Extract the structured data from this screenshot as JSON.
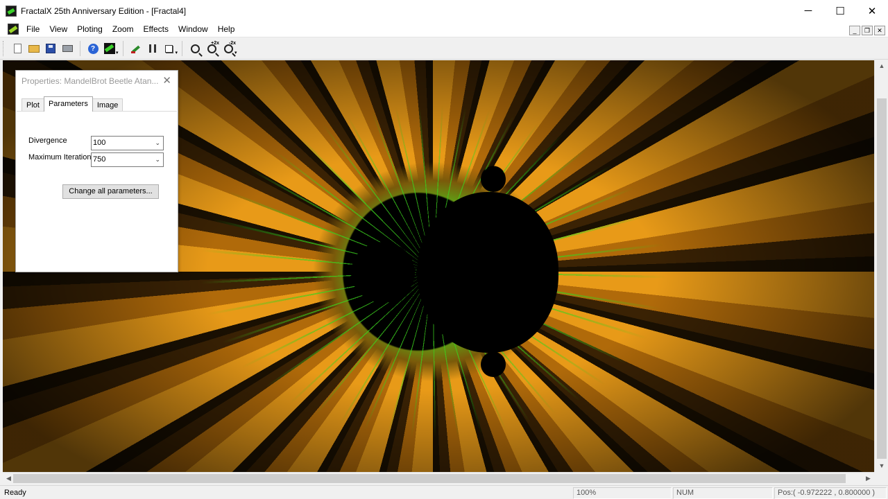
{
  "window": {
    "title": "FractalX 25th Anniversary Edition - [Fractal4]",
    "minimize": "─",
    "maximize": "☐",
    "close": "✕"
  },
  "menu": {
    "items": [
      "File",
      "View",
      "Ploting",
      "Zoom",
      "Effects",
      "Window",
      "Help"
    ],
    "mdi_minimize": "_",
    "mdi_restore": "❐",
    "mdi_close": "✕"
  },
  "toolbar": {
    "zoom_in_label": "+2x",
    "zoom_out_label": "-2x",
    "dropdown_glyph": "▾"
  },
  "properties": {
    "title": "Properties: MandelBrot Beetle Atan...",
    "close_glyph": "✕",
    "tabs": [
      "Plot",
      "Parameters",
      "Image"
    ],
    "active_tab": "Parameters",
    "divergence_label": "Divergence",
    "divergence_value": "100",
    "max_iteration_label": "Maximum Iteration",
    "max_iteration_value": "750",
    "change_button": "Change all parameters..."
  },
  "scroll": {
    "up": "▲",
    "down": "▼",
    "left": "◀",
    "right": "▶"
  },
  "status": {
    "ready": "Ready",
    "zoom": "100%",
    "num": "NUM",
    "position": "Pos:( -0.972222 , 0.800000 )"
  }
}
